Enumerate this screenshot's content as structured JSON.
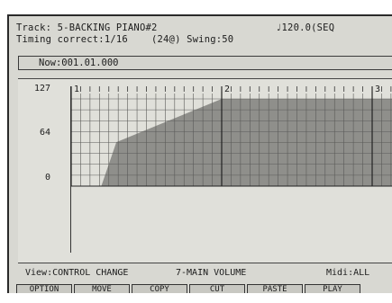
{
  "header": {
    "track": "Track: 5-BACKING PIANO#2",
    "tempo": "♩120.0(SEQ",
    "timing": "Timing correct:1/16    (24@) Swing:50"
  },
  "now": "Now:001.01.000",
  "graph": {
    "y_labels": [
      "127",
      "64",
      "0"
    ],
    "bar_numbers": [
      "1",
      "2",
      "3"
    ]
  },
  "status": {
    "view": "View:CONTROL CHANGE",
    "controller": "7-MAIN VOLUME",
    "midi": "Midi:ALL"
  },
  "buttons": [
    "OPTION",
    "MOVE",
    "COPY",
    "CUT",
    "PASTE",
    "PLAY"
  ],
  "colors": {
    "screen": "#d8d8d2",
    "fill": "#8f8f8b",
    "grid": "#5a5a58"
  },
  "chart_data": {
    "type": "area",
    "ylim": [
      0,
      127
    ],
    "y_ticks": [
      0,
      64,
      127
    ],
    "x_ticks": [
      "1",
      "2",
      "3"
    ],
    "x": [
      0,
      0.2,
      0.3,
      1.0,
      3.2
    ],
    "values": [
      0,
      0,
      64,
      127,
      127
    ]
  }
}
